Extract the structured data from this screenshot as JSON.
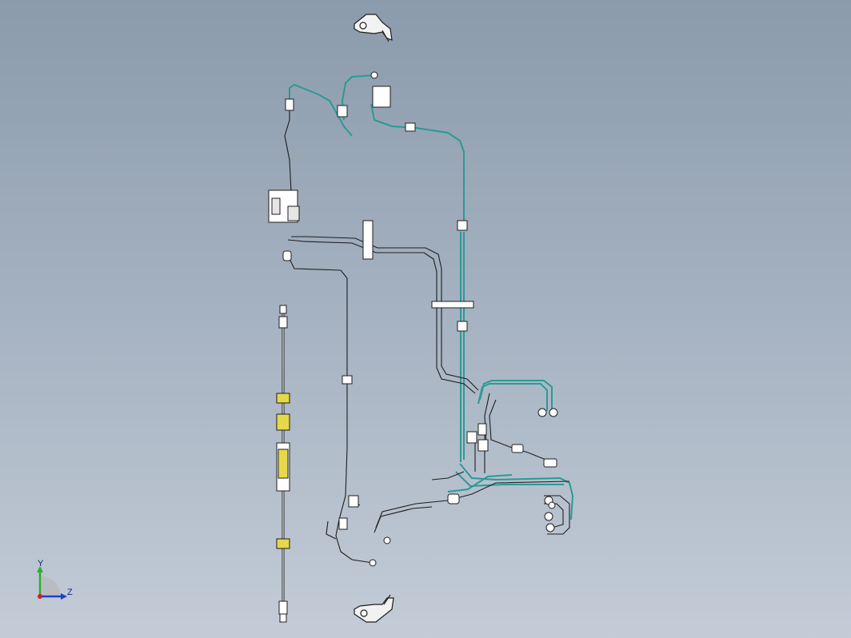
{
  "viewport": {
    "background_top": "#8b9bac",
    "background_bottom": "#c3ccd7"
  },
  "colors": {
    "line": "#1e1e1e",
    "hose": "#2a9a95",
    "fitting_yellow": "#e6d84a"
  },
  "triad": {
    "y_label": "Y",
    "z_label": "Z",
    "y_color": "#2bb02b",
    "z_color": "#2040c8",
    "x_color": "#d02020"
  }
}
